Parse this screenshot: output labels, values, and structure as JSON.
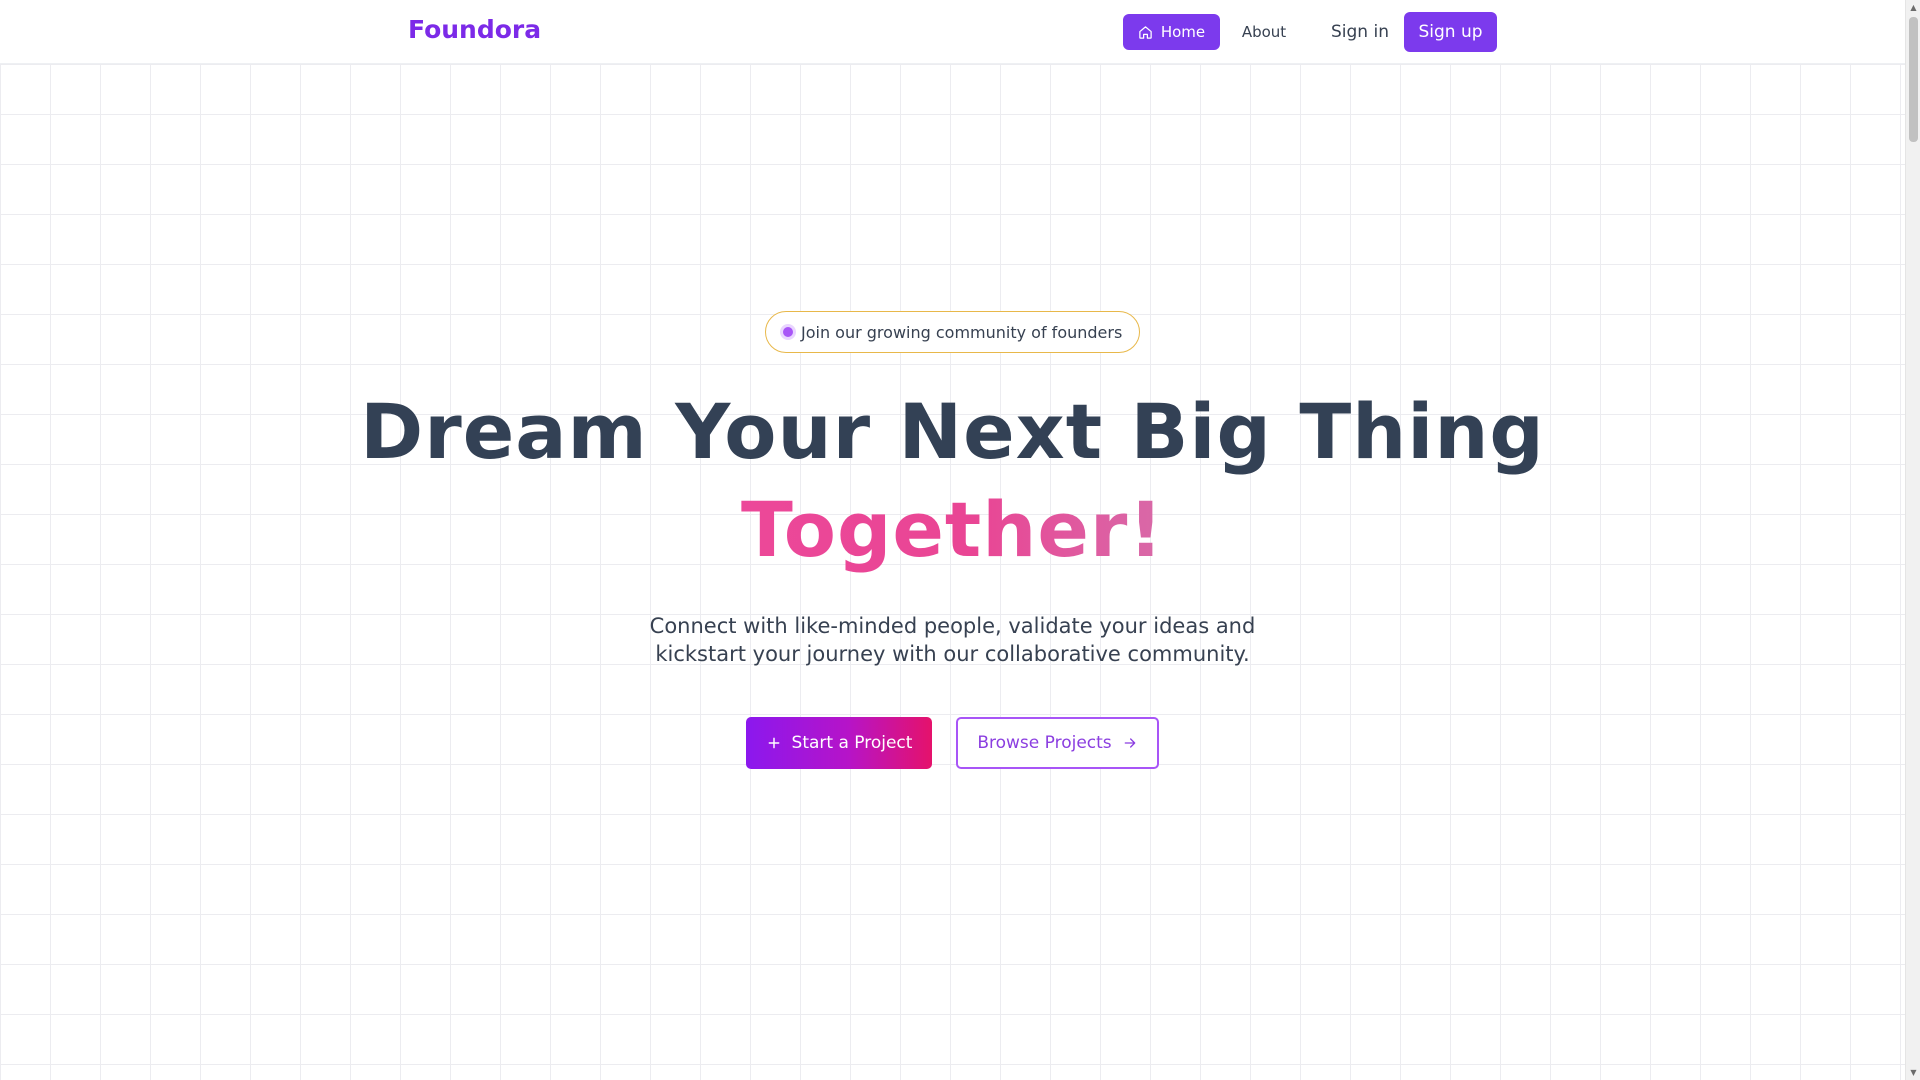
{
  "header": {
    "logo": "Foundora",
    "nav": {
      "home": "Home",
      "about": "About"
    },
    "signin": "Sign in",
    "signup": "Sign up"
  },
  "hero": {
    "badge": "Join our growing community of founders",
    "title": "Dream Your Next Big Thing",
    "accent": "Together!",
    "subtitle": "Connect with like-minded people, validate your ideas and kickstart your journey with our collaborative community.",
    "primary_cta": "Start a Project",
    "secondary_cta": "Browse Projects"
  },
  "colors": {
    "brand": "#7c3aed",
    "accent_pink": "#ec4899",
    "badge_border": "#e8b84a"
  },
  "icons": {
    "home": "home-icon",
    "plus": "plus-icon",
    "arrow": "arrow-right-icon"
  }
}
